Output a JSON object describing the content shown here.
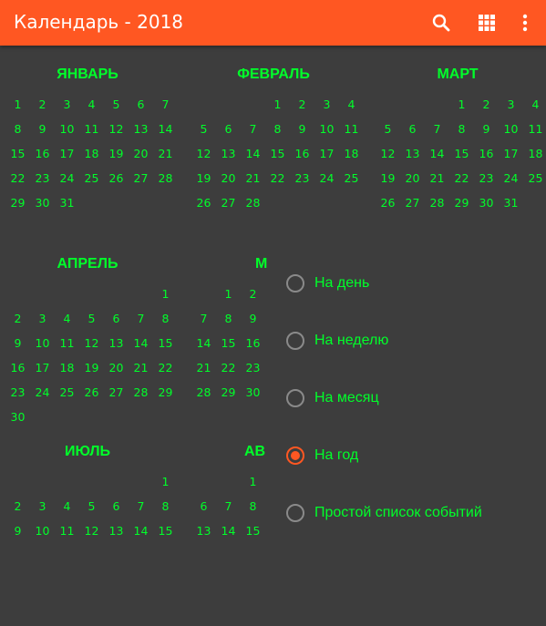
{
  "appbar": {
    "title": "Календарь - 2018",
    "icons": [
      "search-icon",
      "grid-view-icon",
      "more-vert-icon"
    ],
    "accent_color": "#ff5722"
  },
  "colors": {
    "background": "#3d3d3d",
    "text": "#00ff2a"
  },
  "months": [
    {
      "name": "ЯНВАРЬ",
      "weeks": [
        [
          "1",
          "2",
          "3",
          "4",
          "5",
          "6",
          "7"
        ],
        [
          "8",
          "9",
          "10",
          "11",
          "12",
          "13",
          "14"
        ],
        [
          "15",
          "16",
          "17",
          "18",
          "19",
          "20",
          "21"
        ],
        [
          "22",
          "23",
          "24",
          "25",
          "26",
          "27",
          "28"
        ],
        [
          "29",
          "30",
          "31",
          "",
          "",
          "",
          ""
        ]
      ]
    },
    {
      "name": "ФЕВРАЛЬ",
      "weeks": [
        [
          "",
          "",
          "",
          "1",
          "2",
          "3",
          "4"
        ],
        [
          "5",
          "6",
          "7",
          "8",
          "9",
          "10",
          "11"
        ],
        [
          "12",
          "13",
          "14",
          "15",
          "16",
          "17",
          "18"
        ],
        [
          "19",
          "20",
          "21",
          "22",
          "23",
          "24",
          "25"
        ],
        [
          "26",
          "27",
          "28",
          "",
          "",
          "",
          ""
        ]
      ]
    },
    {
      "name": "МАРТ",
      "weeks": [
        [
          "",
          "",
          "",
          "1",
          "2",
          "3",
          "4"
        ],
        [
          "5",
          "6",
          "7",
          "8",
          "9",
          "10",
          "11"
        ],
        [
          "12",
          "13",
          "14",
          "15",
          "16",
          "17",
          "18"
        ],
        [
          "19",
          "20",
          "21",
          "22",
          "23",
          "24",
          "25"
        ],
        [
          "26",
          "27",
          "28",
          "29",
          "30",
          "31",
          ""
        ]
      ]
    },
    {
      "name": "АПРЕЛЬ",
      "weeks": [
        [
          "",
          "",
          "",
          "",
          "",
          "",
          "1"
        ],
        [
          "2",
          "3",
          "4",
          "5",
          "6",
          "7",
          "8"
        ],
        [
          "9",
          "10",
          "11",
          "12",
          "13",
          "14",
          "15"
        ],
        [
          "16",
          "17",
          "18",
          "19",
          "20",
          "21",
          "22"
        ],
        [
          "23",
          "24",
          "25",
          "26",
          "27",
          "28",
          "29"
        ],
        [
          "30",
          "",
          "",
          "",
          "",
          "",
          ""
        ]
      ]
    },
    {
      "name": "М",
      "weeks": [
        [
          "",
          "1",
          "2",
          "",
          "",
          "",
          ""
        ],
        [
          "7",
          "8",
          "9",
          "",
          "",
          "",
          ""
        ],
        [
          "14",
          "15",
          "16",
          "",
          "",
          "",
          ""
        ],
        [
          "21",
          "22",
          "23",
          "",
          "",
          "",
          ""
        ],
        [
          "28",
          "29",
          "30",
          "",
          "",
          "",
          ""
        ]
      ]
    },
    {
      "name": "ИЮЛЬ",
      "weeks": [
        [
          "",
          "",
          "",
          "",
          "",
          "",
          "1"
        ],
        [
          "2",
          "3",
          "4",
          "5",
          "6",
          "7",
          "8"
        ],
        [
          "9",
          "10",
          "11",
          "12",
          "13",
          "14",
          "15"
        ]
      ]
    },
    {
      "name": "АВ",
      "weeks": [
        [
          "",
          "",
          "1",
          "",
          "",
          "",
          ""
        ],
        [
          "6",
          "7",
          "8",
          "",
          "",
          "",
          ""
        ],
        [
          "13",
          "14",
          "15",
          "",
          "",
          "",
          ""
        ]
      ]
    }
  ],
  "view_options": [
    {
      "label": "На день",
      "selected": false
    },
    {
      "label": "На неделю",
      "selected": false
    },
    {
      "label": "На месяц",
      "selected": false
    },
    {
      "label": "На год",
      "selected": true
    },
    {
      "label": "Простой список событий",
      "selected": false
    }
  ]
}
